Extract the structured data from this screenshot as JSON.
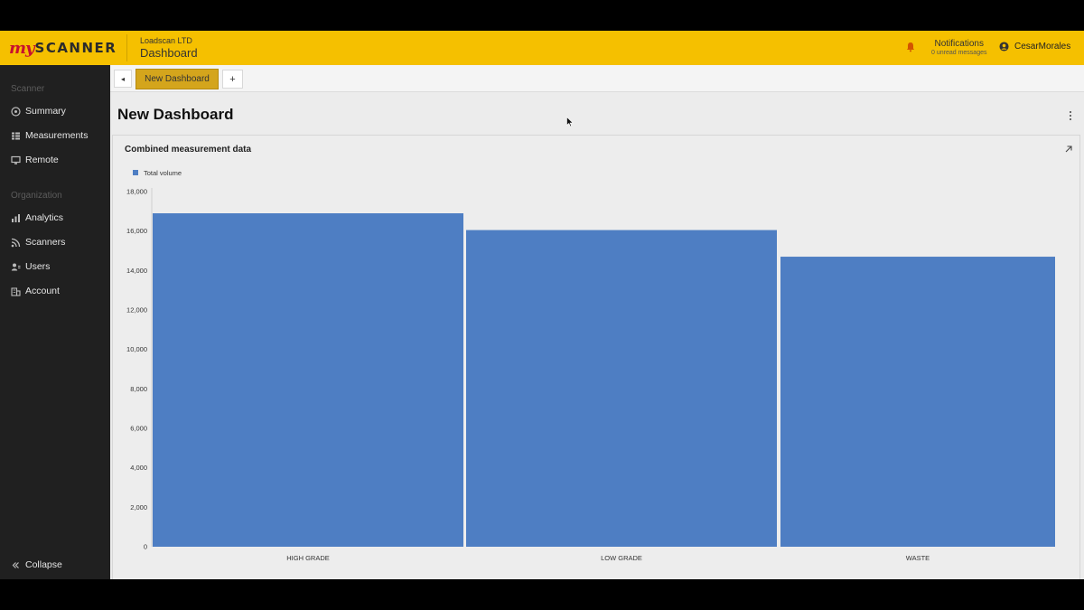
{
  "topbar": {
    "logo_my": "my",
    "logo_scanner": "SCANNER",
    "company": "Loadscan LTD",
    "title": "Dashboard",
    "notifications_title": "Notifications",
    "notifications_sub": "0 unread messages",
    "user_name": "CesarMorales"
  },
  "sidebar": {
    "section_scanner": "Scanner",
    "section_org": "Organization",
    "items": [
      {
        "label": "Summary",
        "icon": "summary-icon"
      },
      {
        "label": "Measurements",
        "icon": "measurements-icon"
      },
      {
        "label": "Remote",
        "icon": "monitor-icon"
      },
      {
        "label": "Analytics",
        "icon": "analytics-icon"
      },
      {
        "label": "Scanners",
        "icon": "rss-icon"
      },
      {
        "label": "Users",
        "icon": "users-icon"
      },
      {
        "label": "Account",
        "icon": "building-icon"
      }
    ],
    "collapse_label": "Collapse"
  },
  "tabs": {
    "back": "◂",
    "active": "New Dashboard",
    "add": "+"
  },
  "page": {
    "title": "New Dashboard"
  },
  "card": {
    "title": "Combined measurement data"
  },
  "colors": {
    "topbar": "#f5c000",
    "sidebar": "#202020",
    "bar": "#4e7ec3",
    "active_tab": "#d4a51c"
  },
  "chart_data": {
    "type": "bar",
    "categories": [
      "HIGH GRADE",
      "LOW GRADE",
      "WASTE"
    ],
    "series": [
      {
        "name": "Total volume",
        "values": [
          16900,
          16050,
          14700
        ]
      }
    ],
    "ylim": [
      0,
      18000
    ],
    "yticks": [
      0,
      2000,
      4000,
      6000,
      8000,
      10000,
      12000,
      14000,
      16000,
      18000
    ],
    "ytick_labels": [
      "0",
      "2,000",
      "4,000",
      "6,000",
      "8,000",
      "10,000",
      "12,000",
      "14,000",
      "16,000",
      "18,000"
    ],
    "legend_position": "top-left",
    "grid": false
  }
}
